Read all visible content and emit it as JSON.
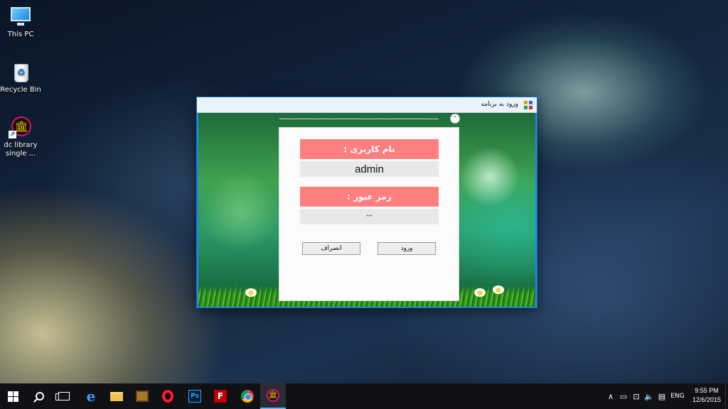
{
  "desktop": {
    "icons": [
      {
        "label": "This PC"
      },
      {
        "label": "Recycle Bin"
      },
      {
        "label_line1": "dc library",
        "label_line2": "single ..."
      }
    ]
  },
  "window": {
    "title": "ورود به برنامه",
    "collapse_glyph": "⌃",
    "username_label": "نام کاربری :",
    "username_value": "admin",
    "password_label": "رمز عبور :",
    "password_value": "***",
    "login_button": "ورود",
    "cancel_button": "انصراف"
  },
  "taskbar": {
    "lang": "ENG",
    "time": "9:55 PM",
    "date": "12/6/2015",
    "ps_label": "Ps",
    "fz_label": "F"
  },
  "colors": {
    "window_accent": "#1e88e5",
    "label_bg": "#ff7f80",
    "field_bg": "#e8e8e8"
  }
}
